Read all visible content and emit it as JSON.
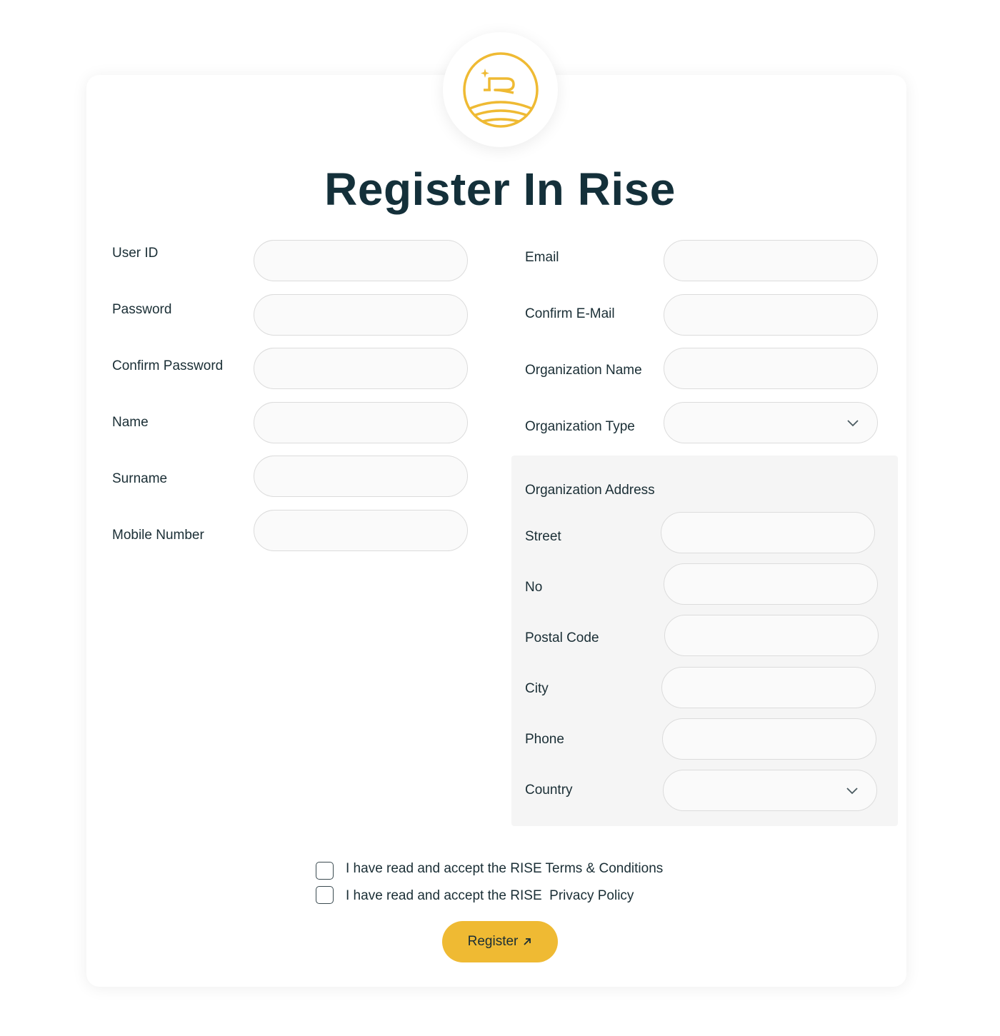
{
  "page_title": "Register In Rise",
  "brand": {
    "accent_color": "#efba33",
    "logo_icon": "rise-logo-icon"
  },
  "left_fields": [
    {
      "label": "User ID"
    },
    {
      "label": "Password"
    },
    {
      "label": "Confirm Password"
    },
    {
      "label": "Name"
    },
    {
      "label": "Surname"
    },
    {
      "label": "Mobile Number"
    }
  ],
  "right_fields": [
    {
      "label": "Email"
    },
    {
      "label": "Confirm E-Mail"
    },
    {
      "label": "Organization Name"
    },
    {
      "label": "Organization Type"
    }
  ],
  "address": {
    "heading": "Organization Address",
    "fields": [
      {
        "label": "Street"
      },
      {
        "label": "No"
      },
      {
        "label": "Postal Code"
      },
      {
        "label": "City"
      },
      {
        "label": "Phone"
      },
      {
        "label": "Country"
      }
    ]
  },
  "agreements": {
    "terms": "I have read and accept the RISE Terms & Conditions",
    "privacy": "I have read and accept the RISE  Privacy Policy"
  },
  "register_button": {
    "label": "Register",
    "icon": "arrow-up-right-icon"
  }
}
